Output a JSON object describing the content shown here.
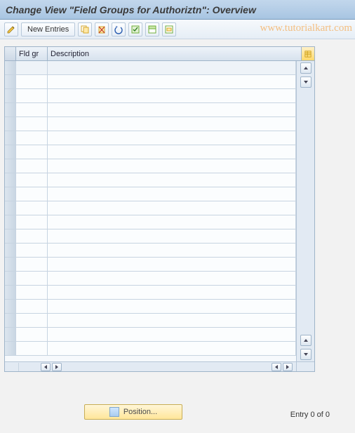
{
  "title": "Change View \"Field Groups for Authoriztn\": Overview",
  "watermark": "www.tutorialkart.com",
  "toolbar": {
    "new_entries": "New Entries"
  },
  "grid": {
    "columns": {
      "fld_gr": "Fld gr",
      "description": "Description"
    },
    "rows": [
      {
        "fld_gr": "",
        "description": ""
      },
      {
        "fld_gr": "",
        "description": ""
      },
      {
        "fld_gr": "",
        "description": ""
      },
      {
        "fld_gr": "",
        "description": ""
      },
      {
        "fld_gr": "",
        "description": ""
      },
      {
        "fld_gr": "",
        "description": ""
      },
      {
        "fld_gr": "",
        "description": ""
      },
      {
        "fld_gr": "",
        "description": ""
      },
      {
        "fld_gr": "",
        "description": ""
      },
      {
        "fld_gr": "",
        "description": ""
      },
      {
        "fld_gr": "",
        "description": ""
      },
      {
        "fld_gr": "",
        "description": ""
      },
      {
        "fld_gr": "",
        "description": ""
      },
      {
        "fld_gr": "",
        "description": ""
      },
      {
        "fld_gr": "",
        "description": ""
      },
      {
        "fld_gr": "",
        "description": ""
      },
      {
        "fld_gr": "",
        "description": ""
      },
      {
        "fld_gr": "",
        "description": ""
      },
      {
        "fld_gr": "",
        "description": ""
      },
      {
        "fld_gr": "",
        "description": ""
      },
      {
        "fld_gr": "",
        "description": ""
      }
    ]
  },
  "footer": {
    "position_label": "Position...",
    "entry_status": "Entry 0 of 0"
  }
}
